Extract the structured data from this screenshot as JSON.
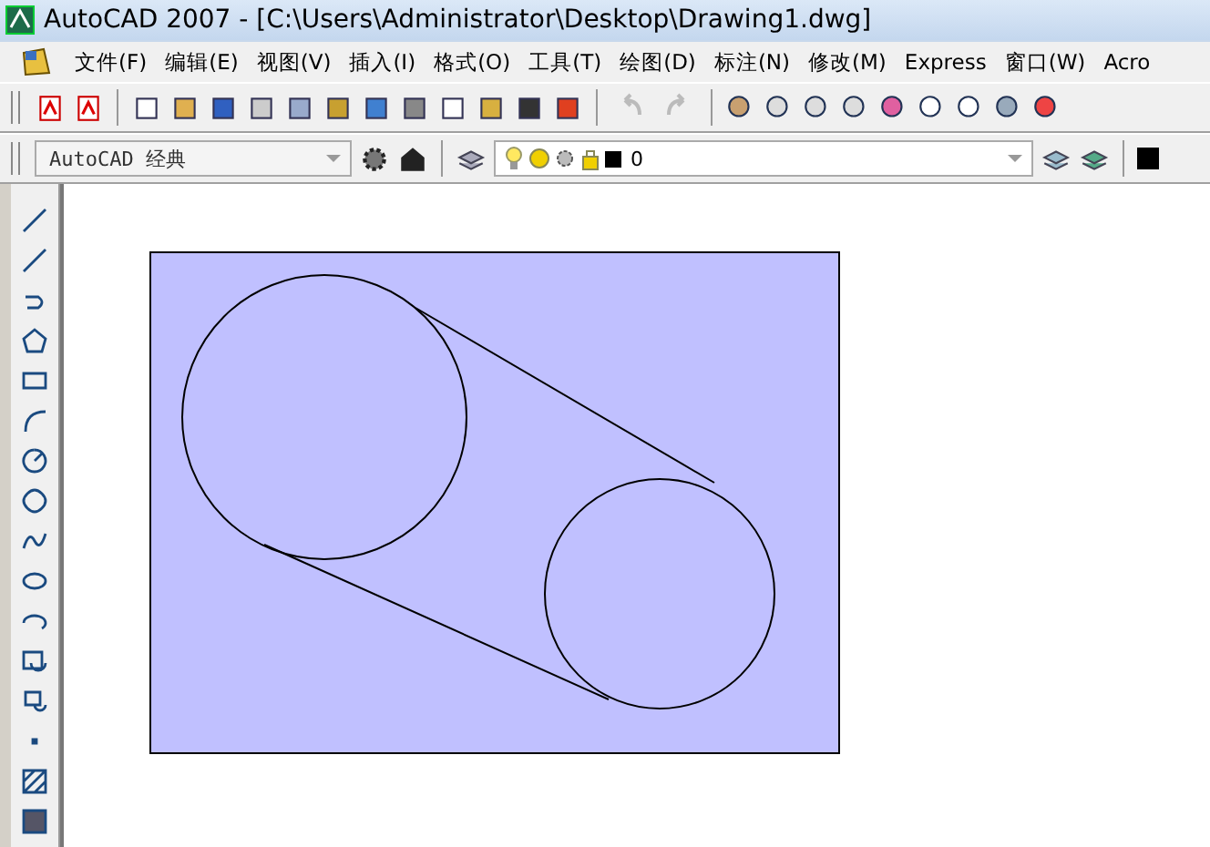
{
  "window": {
    "title": "AutoCAD 2007 - [C:\\Users\\Administrator\\Desktop\\Drawing1.dwg]"
  },
  "menu": [
    {
      "label": "文件(F)"
    },
    {
      "label": "编辑(E)"
    },
    {
      "label": "视图(V)"
    },
    {
      "label": "插入(I)"
    },
    {
      "label": "格式(O)"
    },
    {
      "label": "工具(T)"
    },
    {
      "label": "绘图(D)"
    },
    {
      "label": "标注(N)"
    },
    {
      "label": "修改(M)"
    },
    {
      "label": "Express"
    },
    {
      "label": "窗口(W)"
    },
    {
      "label": "Acro"
    }
  ],
  "history": {
    "undo_disabled": true,
    "redo_disabled": true
  },
  "workspace": {
    "value": "AutoCAD 经典"
  },
  "layer": {
    "value": "0"
  }
}
